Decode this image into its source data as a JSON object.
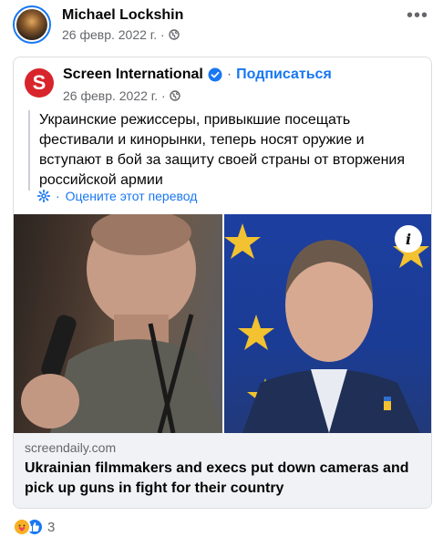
{
  "post": {
    "author": "Michael Lockshin",
    "date": "26 февр. 2022 г. ·",
    "more": "•••"
  },
  "shared": {
    "page_logo_letter": "S",
    "page_name": "Screen International",
    "separator": "·",
    "subscribe": "Подписаться",
    "date": "26 февр. 2022 г. ·",
    "text": "Украинские режиссеры, привыкшие посещать фестивали и кинорынки, теперь носят оружие и вступают в бой за защиту своей страны от вторжения российской армии",
    "translate_separator": "·",
    "translate_label": "Оцените этот перевод",
    "info_button": "i",
    "link_domain": "screendaily.com",
    "link_title": "Ukrainian filmmakers and execs put down cameras and pick up guns in fight for their country"
  },
  "reactions": {
    "count": "3",
    "icons": [
      "care-icon",
      "like-icon"
    ]
  },
  "colors": {
    "accent": "#1877f2",
    "logo_red": "#d8242b",
    "muted_text": "#65676b"
  }
}
